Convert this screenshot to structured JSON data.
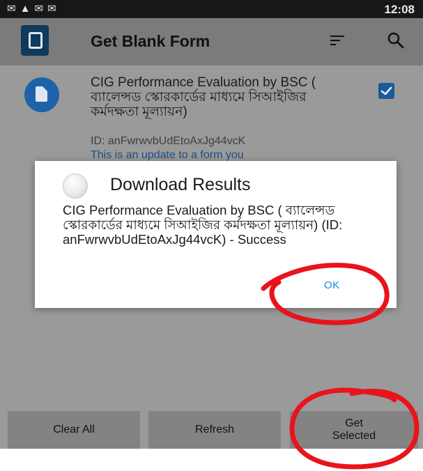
{
  "status_bar": {
    "icons": [
      "mail-icon",
      "warning-icon",
      "message-icon",
      "message-icon"
    ],
    "time": "12:08"
  },
  "app_bar": {
    "title": "Get Blank Form",
    "icons": [
      "sort-icon",
      "search-icon"
    ]
  },
  "form_item": {
    "title": "CIG Performance Evaluation by BSC ( ব্যালেন্সড স্কোরকার্ডের মাধ্যমে সিআইজির কর্মদক্ষতা মূল্যায়ন)",
    "id": "ID: anFwrwvbUdEtoAxJg44vcK",
    "note": "This is an update to a form you",
    "checked": true
  },
  "dialog": {
    "title": "Download Results",
    "message": "CIG Performance Evaluation by BSC ( ব্যালেন্সড স্কোরকার্ডের মাধ্যমে সিআইজির কর্মদক্ষতা মূল্যায়ন) (ID: anFwrwvbUdEtoAxJg44vcK) - Success",
    "ok_label": "OK"
  },
  "bottom_bar": {
    "clear_all": "Clear All",
    "refresh": "Refresh",
    "get_selected_line1": "Get",
    "get_selected_line2": "Selected"
  },
  "colors": {
    "annotation": "#e8141c",
    "accent": "#1e88d5",
    "form_icon": "#1e63a8"
  }
}
